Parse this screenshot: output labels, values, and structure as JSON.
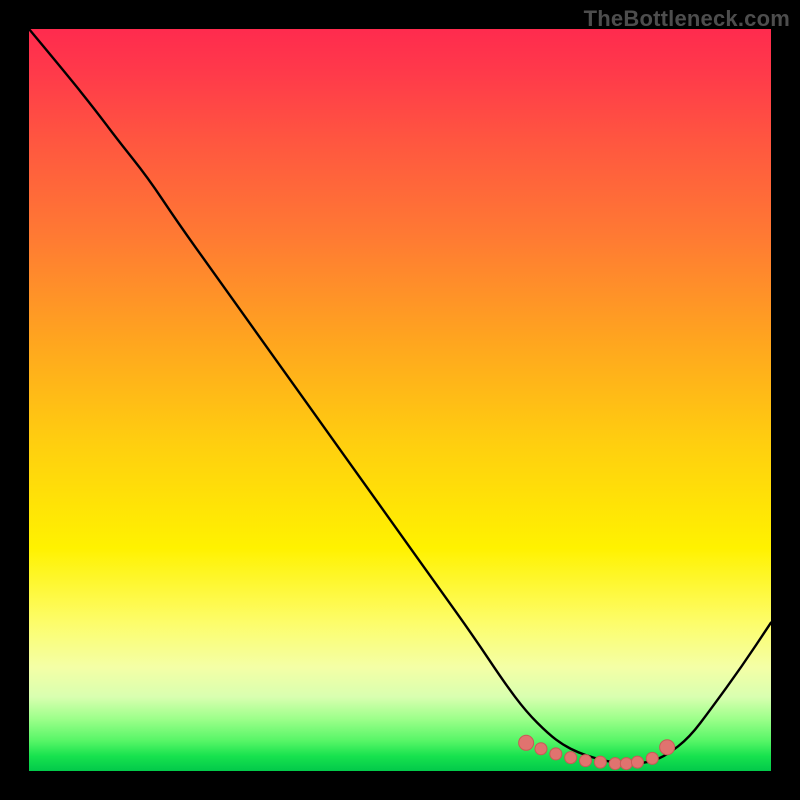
{
  "watermark": "TheBottleneck.com",
  "colors": {
    "background": "#000000",
    "curve_stroke": "#000000",
    "marker_fill": "#e0736f",
    "marker_stroke": "#c85a56"
  },
  "chart_data": {
    "type": "line",
    "title": "",
    "xlabel": "",
    "ylabel": "",
    "xlim": [
      0,
      100
    ],
    "ylim": [
      0,
      100
    ],
    "x": [
      0,
      5,
      9,
      12,
      16,
      20,
      25,
      30,
      35,
      40,
      45,
      50,
      55,
      60,
      64,
      67,
      70,
      72,
      74,
      76,
      78,
      80,
      82,
      84,
      86,
      89,
      92,
      96,
      100
    ],
    "values": [
      100,
      94,
      89,
      85,
      80,
      74,
      67,
      60,
      53,
      46,
      39,
      32,
      25,
      18,
      12,
      8,
      5,
      3.5,
      2.5,
      1.8,
      1.3,
      1.0,
      1.0,
      1.3,
      2.2,
      4.5,
      8.5,
      14,
      20
    ],
    "markers": {
      "x": [
        67,
        69,
        71,
        73,
        75,
        77,
        79,
        80.5,
        82,
        84,
        86
      ],
      "values": [
        3.8,
        3.0,
        2.3,
        1.8,
        1.4,
        1.2,
        1.0,
        1.0,
        1.2,
        1.7,
        3.2
      ]
    }
  }
}
